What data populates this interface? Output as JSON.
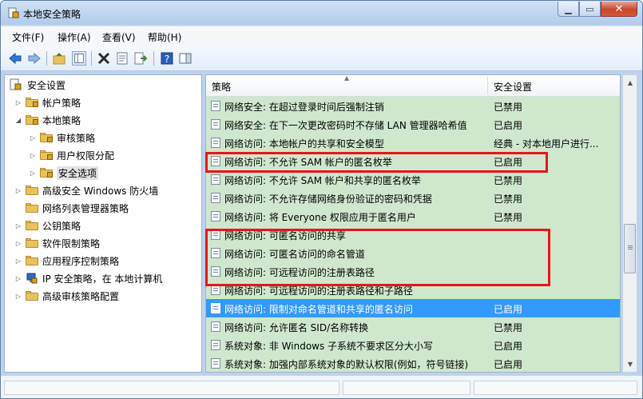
{
  "window": {
    "title": "本地安全策略",
    "min_label": "▁",
    "max_label": "▭",
    "close_label": "✕"
  },
  "menu": [
    "文件(F)",
    "操作(A)",
    "查看(V)",
    "帮助(H)"
  ],
  "tree": {
    "root": "安全设置",
    "items": [
      {
        "label": "帐户策略",
        "expander": "▷"
      },
      {
        "label": "本地策略",
        "expander": "◢"
      },
      {
        "label": "审核策略",
        "expander": "▷"
      },
      {
        "label": "用户权限分配",
        "expander": "▷"
      },
      {
        "label": "安全选项",
        "expander": "▷"
      },
      {
        "label": "高级安全 Windows 防火墙",
        "expander": "▷"
      },
      {
        "label": "网络列表管理器策略",
        "expander": ""
      },
      {
        "label": "公钥策略",
        "expander": "▷"
      },
      {
        "label": "软件限制策略",
        "expander": "▷"
      },
      {
        "label": "应用程序控制策略",
        "expander": "▷"
      },
      {
        "label": "IP 安全策略，在 本地计算机",
        "expander": "▷"
      },
      {
        "label": "高级审核策略配置",
        "expander": "▷"
      }
    ]
  },
  "list": {
    "col_policy": "策略",
    "col_setting": "安全设置",
    "rows": [
      {
        "name": "网络安全: 在超过登录时间后强制注销",
        "value": "已禁用"
      },
      {
        "name": "网络安全: 在下一次更改密码时不存储 LAN 管理器哈希值",
        "value": "已启用"
      },
      {
        "name": "网络访问: 本地帐户的共享和安全模型",
        "value": "经典 - 对本地用户进行..."
      },
      {
        "name": "网络访问: 不允许 SAM 帐户的匿名枚举",
        "value": "已启用"
      },
      {
        "name": "网络访问: 不允许 SAM 帐户和共享的匿名枚举",
        "value": "已禁用"
      },
      {
        "name": "网络访问: 不允许存储网络身份验证的密码和凭据",
        "value": "已禁用"
      },
      {
        "name": "网络访问: 将 Everyone 权限应用于匿名用户",
        "value": "已禁用"
      },
      {
        "name": "网络访问: 可匿名访问的共享",
        "value": ""
      },
      {
        "name": "网络访问: 可匿名访问的命名管道",
        "value": ""
      },
      {
        "name": "网络访问: 可远程访问的注册表路径",
        "value": ""
      },
      {
        "name": "网络访问: 可远程访问的注册表路径和子路径",
        "value": ""
      },
      {
        "name": "网络访问: 限制对命名管道和共享的匿名访问",
        "value": "已启用"
      },
      {
        "name": "网络访问: 允许匿名 SID/名称转换",
        "value": "已禁用"
      },
      {
        "name": "系统对象: 非 Windows 子系统不要求区分大小写",
        "value": "已启用"
      },
      {
        "name": "系统对象: 加强内部系统对象的默认权限(例如，符号链接)",
        "value": "已启用"
      }
    ]
  },
  "colors": {
    "accent": "#3399ff",
    "list_bg": "#cfe8cd",
    "highlight": "#e8141c"
  }
}
